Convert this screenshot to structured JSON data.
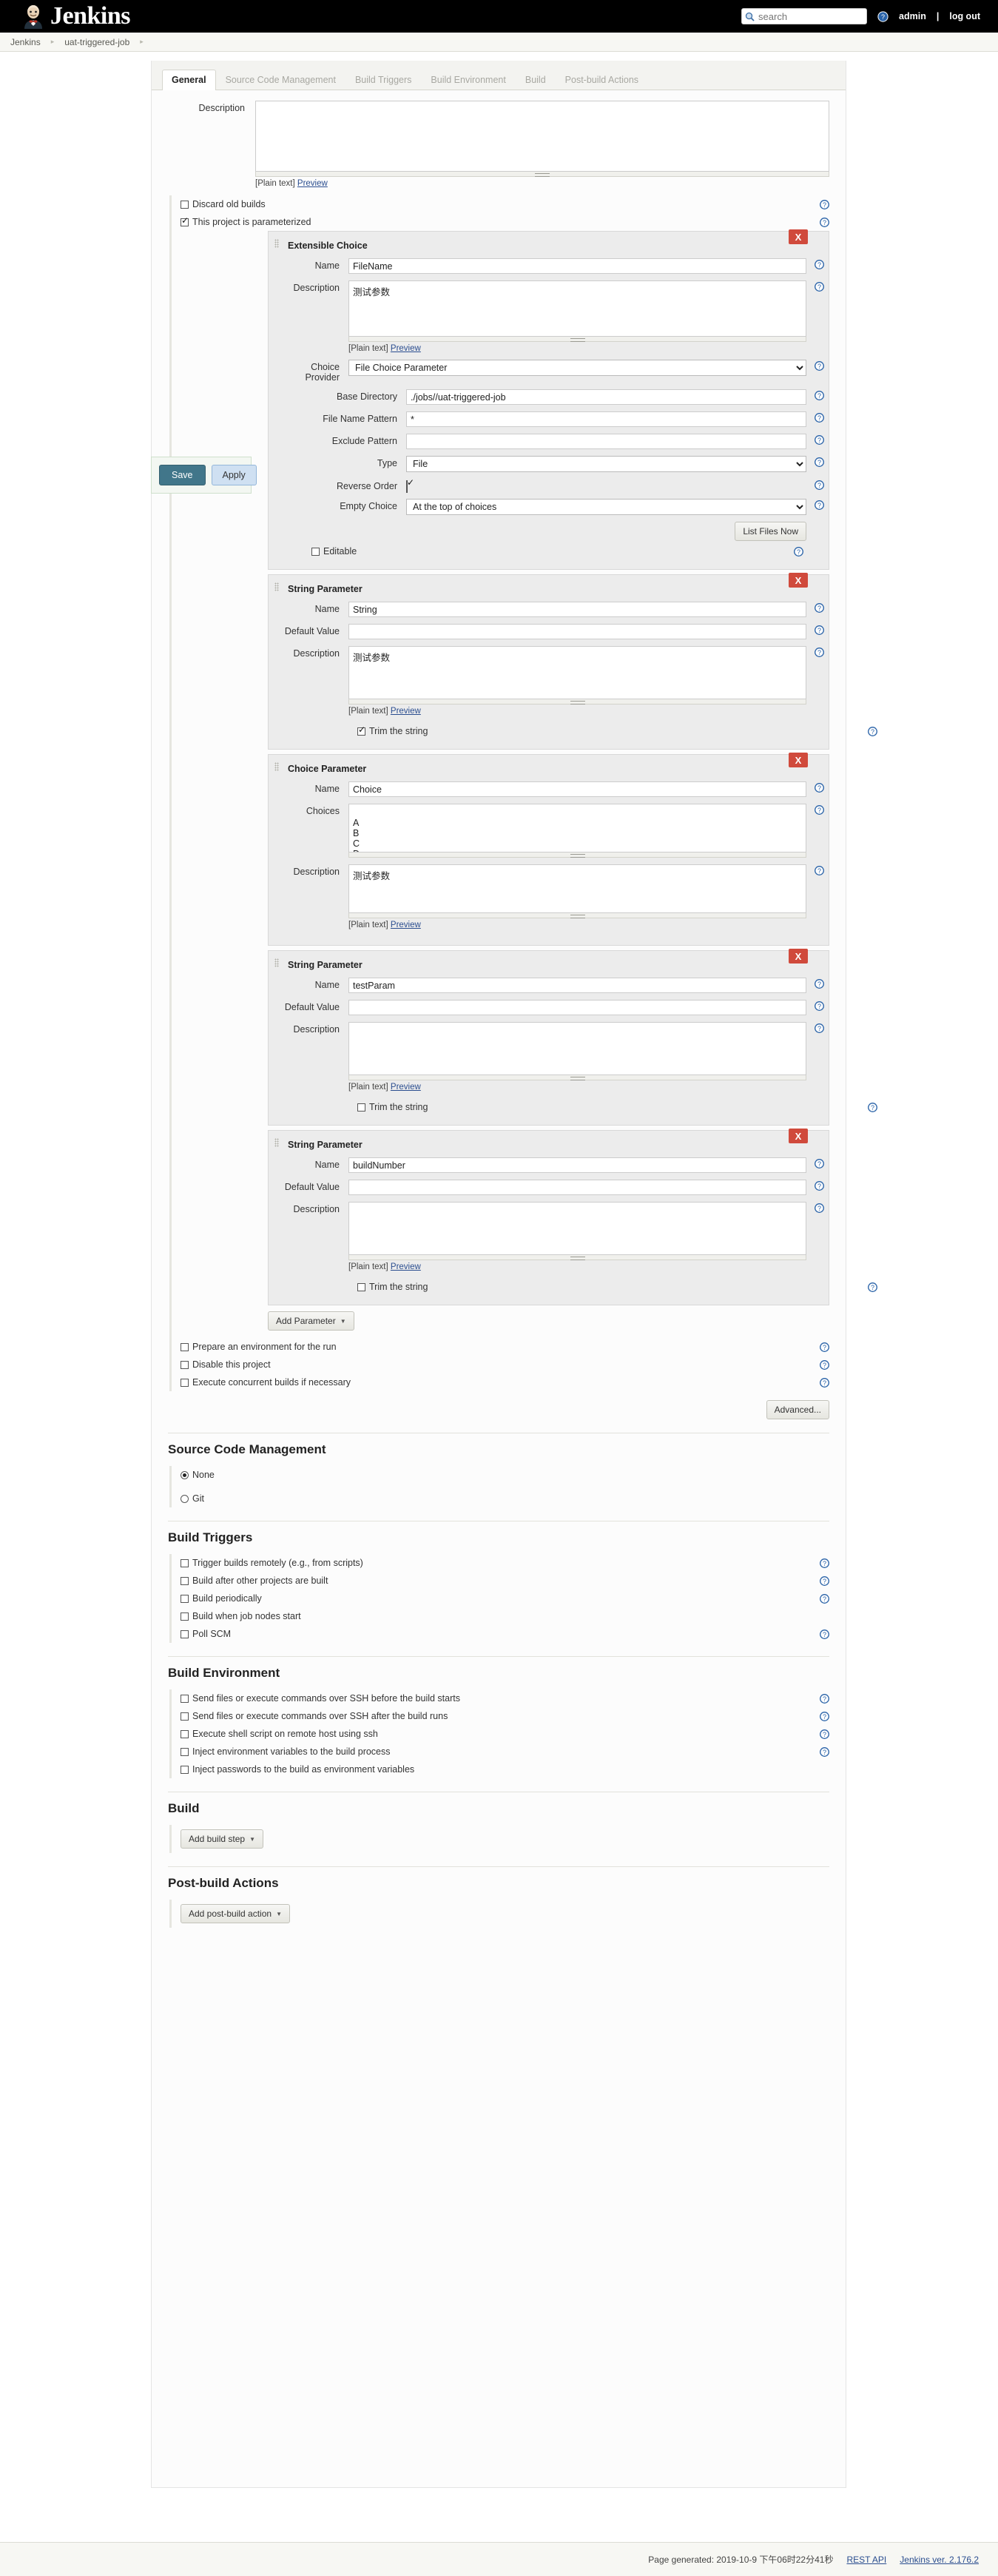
{
  "header": {
    "brand": "Jenkins",
    "logo_icon": "jenkins-butler-icon",
    "search_placeholder": "search",
    "search_value": "",
    "search_icon": "magnifier-icon",
    "help_icon": "help-circle-icon",
    "user": "admin",
    "separator": "|",
    "logout": "log out"
  },
  "breadcrumb": {
    "items": [
      {
        "label": "Jenkins"
      },
      {
        "label": "uat-triggered-job"
      }
    ],
    "arrow": "▸"
  },
  "tabs": [
    {
      "label": "General",
      "active": true
    },
    {
      "label": "Source Code Management",
      "active": false
    },
    {
      "label": "Build Triggers",
      "active": false
    },
    {
      "label": "Build Environment",
      "active": false
    },
    {
      "label": "Build",
      "active": false
    },
    {
      "label": "Post-build Actions",
      "active": false
    }
  ],
  "save_bar": {
    "save_label": "Save",
    "apply_label": "Apply"
  },
  "general": {
    "description_label": "Description",
    "description_value": "",
    "plain_text_label": "[Plain text]",
    "preview_label": "Preview",
    "discard_old_builds": {
      "label": "Discard old builds",
      "checked": false
    },
    "is_parameterized": {
      "label": "This project is parameterized",
      "checked": true
    },
    "prepare_env": {
      "label": "Prepare an environment for the run",
      "checked": false
    },
    "disable_project": {
      "label": "Disable this project",
      "checked": false
    },
    "concurrent_builds": {
      "label": "Execute concurrent builds if necessary",
      "checked": false
    },
    "advanced_label": "Advanced...",
    "add_parameter_label": "Add Parameter"
  },
  "parameters": [
    {
      "type_title": "Extensible Choice",
      "delete_label": "X",
      "name_label": "Name",
      "name_value": "FileName",
      "description_label": "Description",
      "description_value": "测试参数",
      "plain_text_label": "[Plain text]",
      "preview_label": "Preview",
      "choice_provider_label": "Choice Provider",
      "choice_provider_value": "File Choice Parameter",
      "choice_provider_options": [
        "File Choice Parameter"
      ],
      "provider": {
        "base_directory_label": "Base Directory",
        "base_directory_value": "./jobs//uat-triggered-job",
        "file_name_pattern_label": "File Name Pattern",
        "file_name_pattern_value": "*",
        "exclude_pattern_label": "Exclude Pattern",
        "exclude_pattern_value": "",
        "type_label": "Type",
        "type_value": "File",
        "type_options": [
          "File"
        ],
        "reverse_order_label": "Reverse Order",
        "reverse_order_checked": true,
        "empty_choice_label": "Empty Choice",
        "empty_choice_value": "At the top of choices",
        "empty_choice_options": [
          "At the top of choices"
        ],
        "list_files_label": "List Files Now"
      },
      "editable_label": "Editable",
      "editable_checked": false
    },
    {
      "type_title": "String Parameter",
      "delete_label": "X",
      "name_label": "Name",
      "name_value": "String",
      "default_value_label": "Default Value",
      "default_value": "",
      "description_label": "Description",
      "description_value": "测试参数",
      "plain_text_label": "[Plain text]",
      "preview_label": "Preview",
      "trim_label": "Trim the string",
      "trim_checked": true
    },
    {
      "type_title": "Choice Parameter",
      "delete_label": "X",
      "name_label": "Name",
      "name_value": "Choice",
      "choices_label": "Choices",
      "choices_value": "\nA\nB\nC\nD",
      "description_label": "Description",
      "description_value": "测试参数",
      "plain_text_label": "[Plain text]",
      "preview_label": "Preview"
    },
    {
      "type_title": "String Parameter",
      "delete_label": "X",
      "name_label": "Name",
      "name_value": "testParam",
      "default_value_label": "Default Value",
      "default_value": "",
      "description_label": "Description",
      "description_value": "",
      "plain_text_label": "[Plain text]",
      "preview_label": "Preview",
      "trim_label": "Trim the string",
      "trim_checked": false
    },
    {
      "type_title": "String Parameter",
      "delete_label": "X",
      "name_label": "Name",
      "name_value": "buildNumber",
      "default_value_label": "Default Value",
      "default_value": "",
      "description_label": "Description",
      "description_value": "",
      "plain_text_label": "[Plain text]",
      "preview_label": "Preview",
      "trim_label": "Trim the string",
      "trim_checked": false
    }
  ],
  "scm": {
    "title": "Source Code Management",
    "options": [
      {
        "label": "None",
        "selected": true
      },
      {
        "label": "Git",
        "selected": false
      }
    ]
  },
  "build_triggers": {
    "title": "Build Triggers",
    "items": [
      {
        "label": "Trigger builds remotely (e.g., from scripts)",
        "checked": false,
        "help": true
      },
      {
        "label": "Build after other projects are built",
        "checked": false,
        "help": true
      },
      {
        "label": "Build periodically",
        "checked": false,
        "help": true
      },
      {
        "label": "Build when job nodes start",
        "checked": false,
        "help": false
      },
      {
        "label": "Poll SCM",
        "checked": false,
        "help": true
      }
    ]
  },
  "build_environment": {
    "title": "Build Environment",
    "items": [
      {
        "label": "Send files or execute commands over SSH before the build starts",
        "checked": false,
        "help": true
      },
      {
        "label": "Send files or execute commands over SSH after the build runs",
        "checked": false,
        "help": true
      },
      {
        "label": "Execute shell script on remote host using ssh",
        "checked": false,
        "help": true
      },
      {
        "label": "Inject environment variables to the build process",
        "checked": false,
        "help": true
      },
      {
        "label": "Inject passwords to the build as environment variables",
        "checked": false,
        "help": false
      }
    ]
  },
  "build": {
    "title": "Build",
    "add_build_step_label": "Add build step"
  },
  "post_build": {
    "title": "Post-build Actions",
    "add_post_build_label": "Add post-build action"
  },
  "footer": {
    "generated": "Page generated: 2019-10-9 下午06时22分41秒",
    "rest_api": "REST API",
    "version": "Jenkins ver. 2.176.2"
  },
  "colors": {
    "accent_save": "#41768a",
    "accent_apply": "#cfe0f2",
    "delete_red": "#d04a3c",
    "link_blue": "#2a4d8f"
  }
}
